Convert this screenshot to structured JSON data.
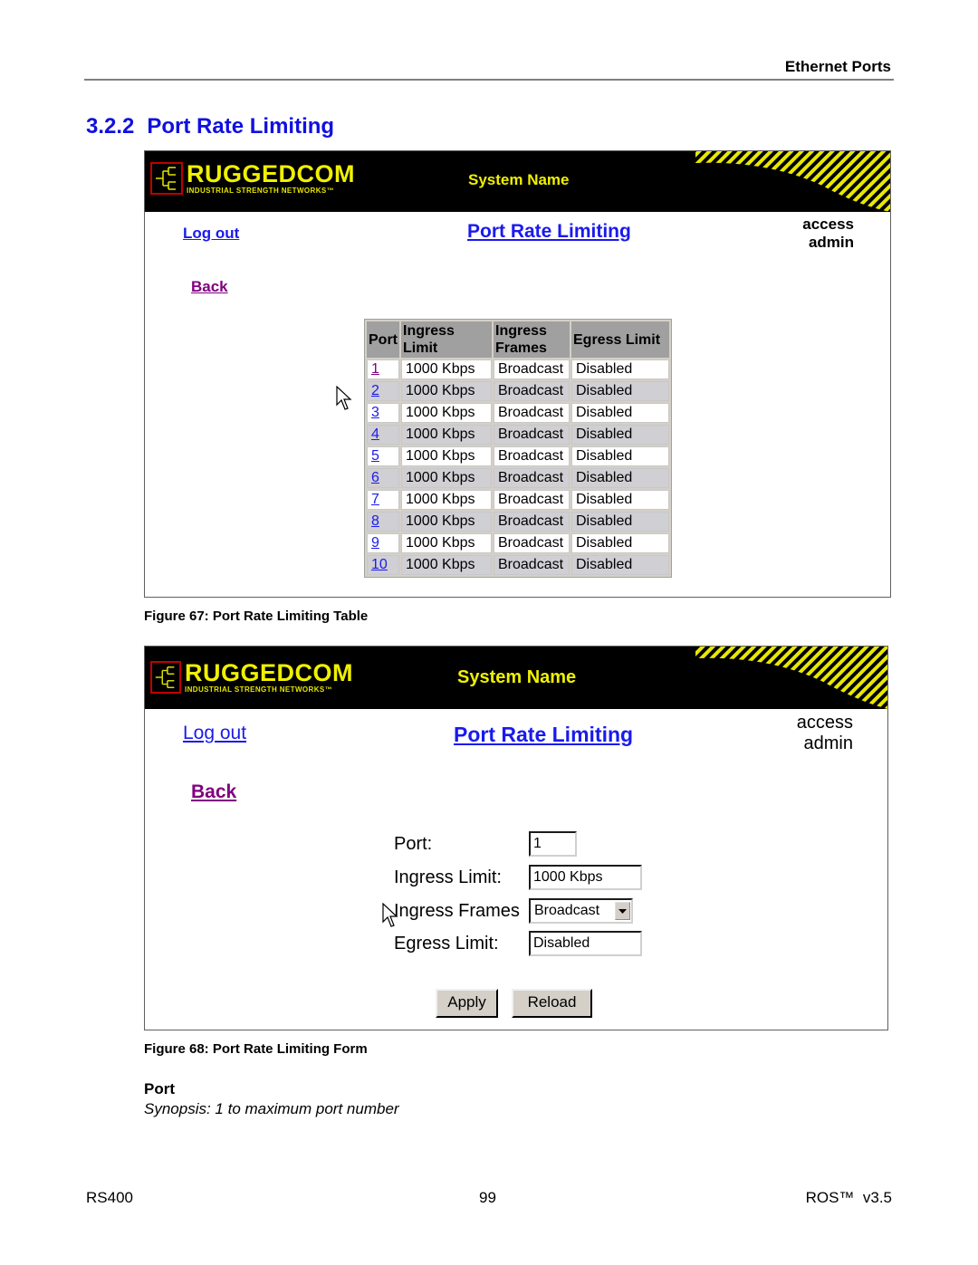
{
  "page": {
    "running_head": "Ethernet Ports",
    "section_number": "3.2.2",
    "section_title": "Port Rate Limiting"
  },
  "banner": {
    "logo_main": "RUGGEDCOM",
    "logo_sub": "INDUSTRIAL STRENGTH NETWORKS™",
    "system_name": "System Name",
    "colors": {
      "background": "#000000",
      "accent": "#f0f000",
      "logo_border": "#c00000"
    }
  },
  "figure67": {
    "logout_label": "Log out",
    "page_title": "Port Rate Limiting",
    "access_label": "access",
    "access_value": "admin",
    "back_label": "Back",
    "table": {
      "headers": [
        "Port",
        "Ingress Limit",
        "Ingress Frames",
        "Egress Limit"
      ],
      "rows": [
        {
          "port": "1",
          "ingress_limit": "1000 Kbps",
          "ingress_frames": "Broadcast",
          "egress_limit": "Disabled",
          "visited": true
        },
        {
          "port": "2",
          "ingress_limit": "1000 Kbps",
          "ingress_frames": "Broadcast",
          "egress_limit": "Disabled"
        },
        {
          "port": "3",
          "ingress_limit": "1000 Kbps",
          "ingress_frames": "Broadcast",
          "egress_limit": "Disabled"
        },
        {
          "port": "4",
          "ingress_limit": "1000 Kbps",
          "ingress_frames": "Broadcast",
          "egress_limit": "Disabled"
        },
        {
          "port": "5",
          "ingress_limit": "1000 Kbps",
          "ingress_frames": "Broadcast",
          "egress_limit": "Disabled"
        },
        {
          "port": "6",
          "ingress_limit": "1000 Kbps",
          "ingress_frames": "Broadcast",
          "egress_limit": "Disabled"
        },
        {
          "port": "7",
          "ingress_limit": "1000 Kbps",
          "ingress_frames": "Broadcast",
          "egress_limit": "Disabled"
        },
        {
          "port": "8",
          "ingress_limit": "1000 Kbps",
          "ingress_frames": "Broadcast",
          "egress_limit": "Disabled"
        },
        {
          "port": "9",
          "ingress_limit": "1000 Kbps",
          "ingress_frames": "Broadcast",
          "egress_limit": "Disabled"
        },
        {
          "port": "10",
          "ingress_limit": "1000 Kbps",
          "ingress_frames": "Broadcast",
          "egress_limit": "Disabled"
        }
      ]
    },
    "caption": "Figure 67: Port Rate Limiting Table"
  },
  "figure68": {
    "logout_label": "Log out",
    "page_title": "Port Rate Limiting",
    "access_label": "access",
    "access_value": "admin",
    "back_label": "Back",
    "form": {
      "port_label": "Port:",
      "port_value": "1",
      "ingress_limit_label": "Ingress Limit:",
      "ingress_limit_value": "1000 Kbps",
      "ingress_frames_label": "Ingress Frames",
      "ingress_frames_value": "Broadcast",
      "egress_limit_label": "Egress Limit:",
      "egress_limit_value": "Disabled",
      "apply_label": "Apply",
      "reload_label": "Reload"
    },
    "caption": "Figure 68: Port Rate Limiting Form"
  },
  "parameter": {
    "name": "Port",
    "synopsis": "Synopsis: 1 to maximum port number"
  },
  "footer": {
    "left": "RS400",
    "center": "99",
    "right": "ROS™  v3.5"
  },
  "colors": {
    "section_title": "#1010e0",
    "link": "#1a1aee",
    "visited_link": "#800080",
    "table_header": "#a0a0a0",
    "row_alt": "#d0cfd3"
  }
}
